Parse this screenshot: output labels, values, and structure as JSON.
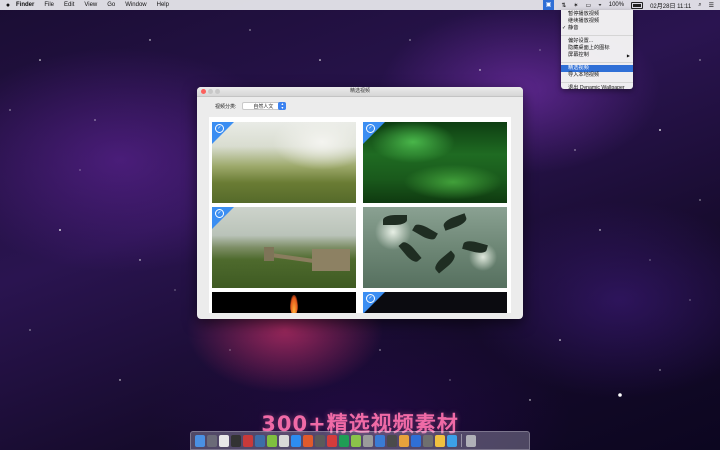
{
  "menubar": {
    "apple_icon": "apple-icon",
    "items": [
      "Finder",
      "File",
      "Edit",
      "View",
      "Go",
      "Window",
      "Help"
    ],
    "status": {
      "battery": "100%",
      "datetime": "02月28日 11:11"
    }
  },
  "dropdown": {
    "items": [
      {
        "label": "暂停播放视频"
      },
      {
        "label": "继续播放视频"
      },
      {
        "label": "静音",
        "checked": true
      },
      {
        "label": "偏好设置..."
      },
      {
        "label": "隐藏桌面上的图标"
      },
      {
        "label": "屏幕控制",
        "submenu": true
      },
      {
        "label": "精选视频",
        "active": true
      },
      {
        "label": "导入本地视频"
      },
      {
        "label": "退出 Dynamic Wallpaper"
      }
    ]
  },
  "window": {
    "title": "精选视频",
    "category_label": "视频分类:",
    "category_value": "自然人文",
    "thumbnails": [
      {
        "name": "mist-forest",
        "selected": true
      },
      {
        "name": "green-leaves",
        "selected": true
      },
      {
        "name": "great-wall",
        "selected": true
      },
      {
        "name": "tree-silhouette",
        "selected": false
      },
      {
        "name": "fire",
        "selected": false
      },
      {
        "name": "dark-scene",
        "selected": true
      }
    ]
  },
  "banner": {
    "text": "300+精选视频素材"
  },
  "colors": {
    "accent": "#3b8ef2",
    "menu_active": "#2f6fd6",
    "banner": "#f06aa6"
  }
}
